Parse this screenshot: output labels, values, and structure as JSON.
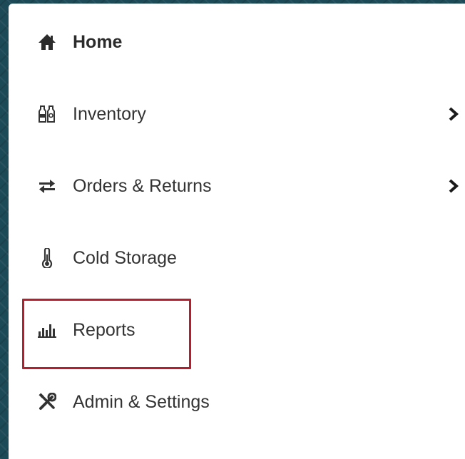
{
  "menu": {
    "items": [
      {
        "id": "home",
        "label": "Home",
        "icon": "home-icon",
        "has_submenu": false,
        "bold": true
      },
      {
        "id": "inventory",
        "label": "Inventory",
        "icon": "bottles-icon",
        "has_submenu": true,
        "bold": false
      },
      {
        "id": "orders",
        "label": "Orders & Returns",
        "icon": "exchange-arrows-icon",
        "has_submenu": true,
        "bold": false
      },
      {
        "id": "cold-storage",
        "label": "Cold Storage",
        "icon": "thermometer-icon",
        "has_submenu": false,
        "bold": false
      },
      {
        "id": "reports",
        "label": "Reports",
        "icon": "bar-chart-icon",
        "has_submenu": false,
        "bold": false,
        "highlighted": true
      },
      {
        "id": "admin",
        "label": "Admin & Settings",
        "icon": "tools-icon",
        "has_submenu": false,
        "bold": false
      }
    ]
  },
  "colors": {
    "background": "#1d4a57",
    "panel": "#ffffff",
    "text": "#333333",
    "icon": "#333333",
    "highlight_border": "#b31f2d"
  }
}
